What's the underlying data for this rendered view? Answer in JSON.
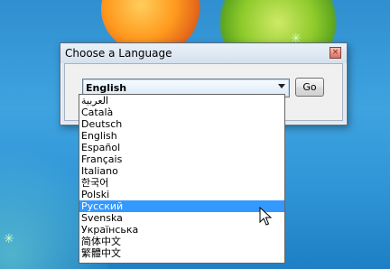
{
  "dialog": {
    "title": "Choose a Language",
    "close_glyph": "×",
    "language_combo": {
      "value": "English"
    },
    "go_label": "Go"
  },
  "dropdown": {
    "items": [
      "العربية",
      "Català",
      "Deutsch",
      "English",
      "Español",
      "Français",
      "Italiano",
      "한국어",
      "Polski",
      "Русский",
      "Svenska",
      "Українська",
      "简体中文",
      "繁體中文"
    ],
    "highlighted": "Русский"
  },
  "colors": {
    "selection_bg": "#3399ff",
    "desktop_blue": "#2f8fd0"
  }
}
